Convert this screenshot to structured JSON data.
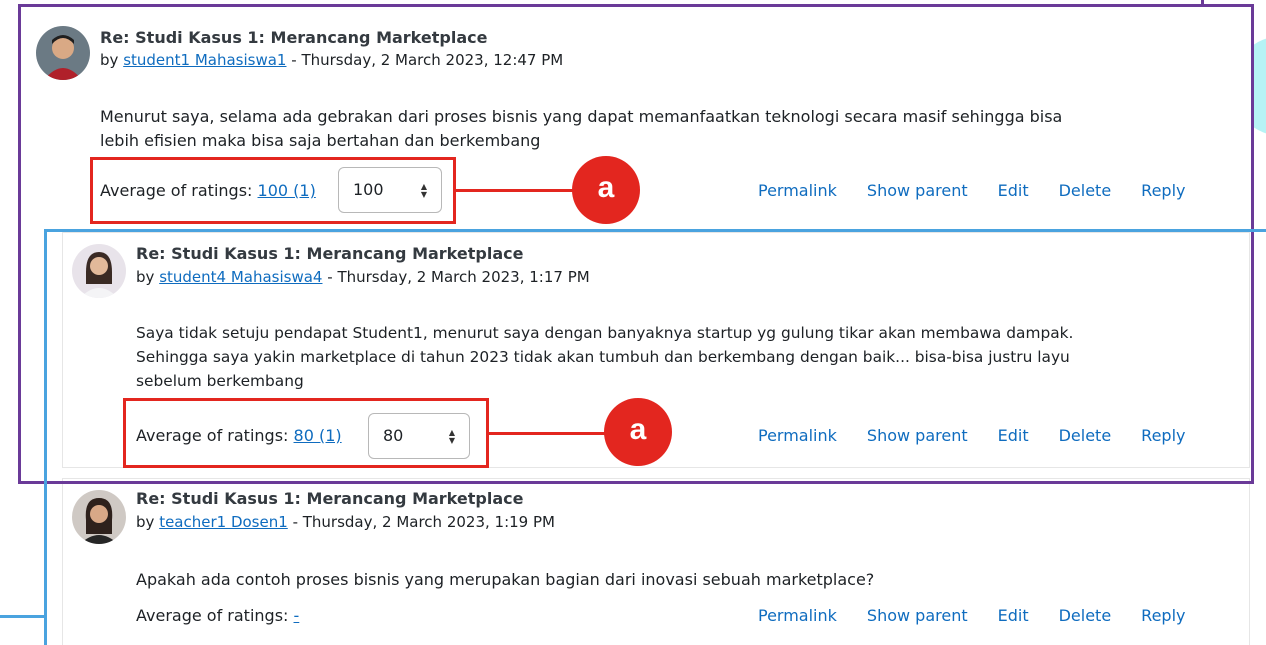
{
  "colors": {
    "link": "#0f6cbf",
    "purple_frame": "#6a3a98",
    "blue_frame": "#4aa3df",
    "red_highlight": "#e3261f",
    "callout": "#e3261f"
  },
  "posts": [
    {
      "subject": "Re: Studi Kasus 1: Merancang Marketplace",
      "by_prefix": "by",
      "author": "student1 Mahasiswa1",
      "date": "- Thursday, 2 March 2023, 12:47 PM",
      "body_line1": "Menurut saya, selama ada gebrakan dari proses bisnis yang dapat memanfaatkan teknologi secara masif sehingga bisa",
      "body_line2": "lebih efisien maka bisa saja bertahan dan berkembang",
      "rating_label": "Average of ratings:",
      "rating_value": "100 (1)",
      "rating_select": "100"
    },
    {
      "subject": "Re: Studi Kasus 1: Merancang Marketplace",
      "by_prefix": "by",
      "author": "student4 Mahasiswa4",
      "date": "- Thursday, 2 March 2023, 1:17 PM",
      "body_line1": "Saya tidak setuju pendapat Student1, menurut saya dengan banyaknya startup yg gulung tikar akan membawa dampak.",
      "body_line2": "Sehingga saya yakin marketplace di tahun 2023 tidak akan tumbuh dan berkembang dengan baik... bisa-bisa justru layu",
      "body_line3": "sebelum berkembang",
      "rating_label": "Average of ratings:",
      "rating_value": "80 (1)",
      "rating_select": "80"
    },
    {
      "subject": "Re: Studi Kasus 1: Merancang Marketplace",
      "by_prefix": "by",
      "author": "teacher1 Dosen1",
      "date": "- Thursday, 2 March 2023, 1:19 PM",
      "body_line1": "Apakah ada contoh proses bisnis yang merupakan bagian dari inovasi sebuah marketplace?",
      "rating_label": "Average of ratings:",
      "rating_value": "-"
    }
  ],
  "actions": {
    "permalink": "Permalink",
    "show_parent": "Show parent",
    "edit": "Edit",
    "delete": "Delete",
    "reply": "Reply"
  },
  "callouts": {
    "first": "a",
    "second": "a"
  }
}
